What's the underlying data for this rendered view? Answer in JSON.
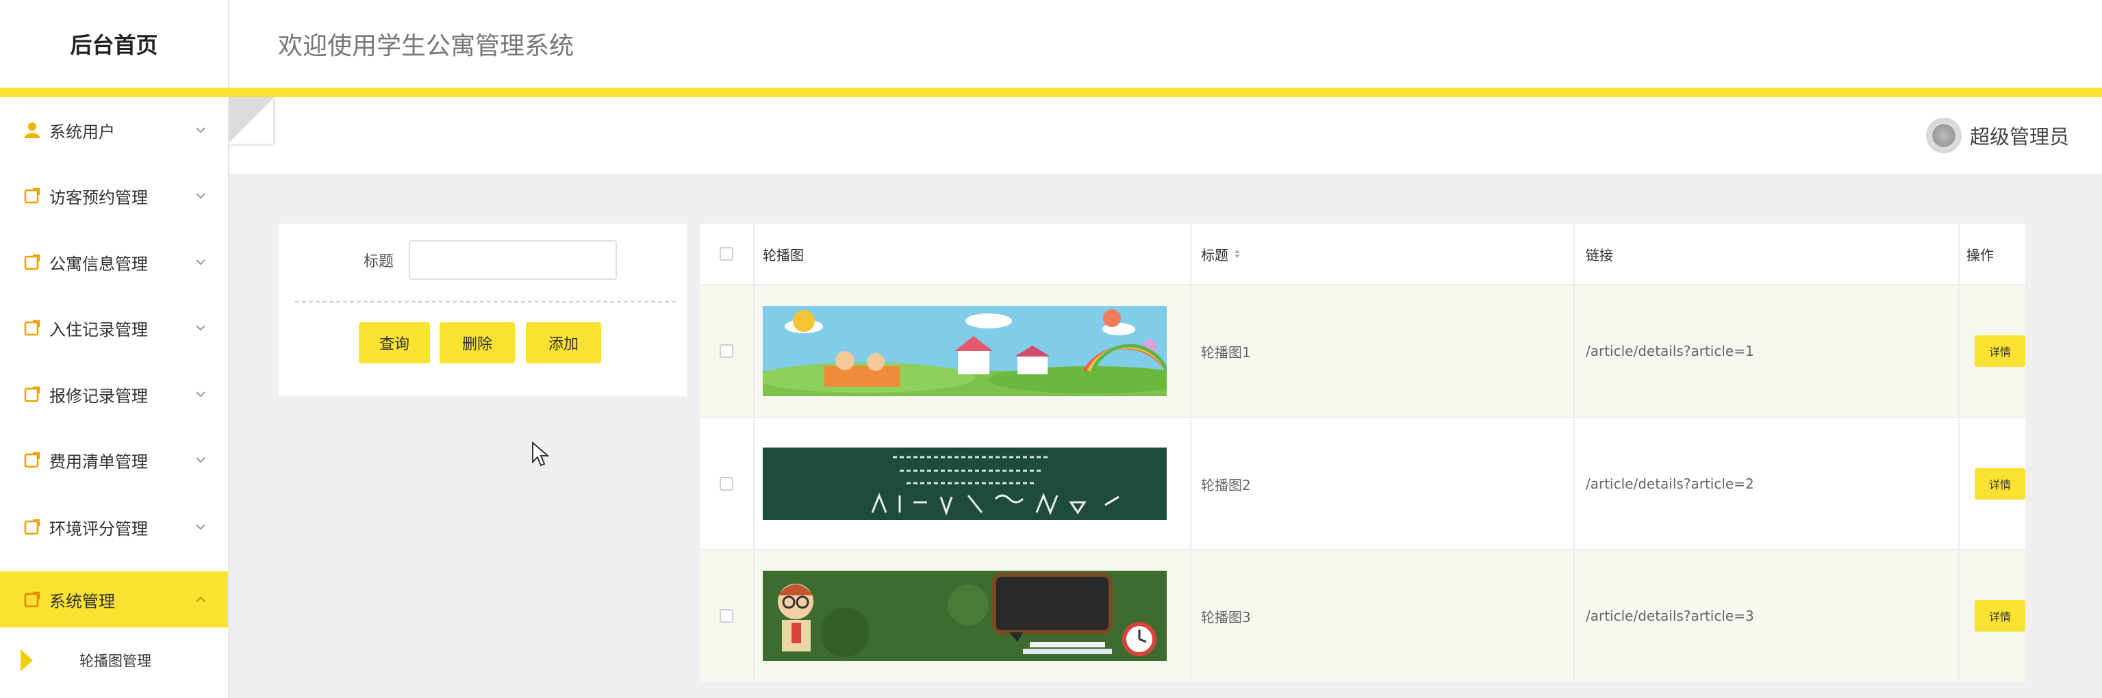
{
  "header": {
    "brand": "后台首页",
    "welcome": "欢迎使用学生公寓管理系统",
    "accent_color": "#f9e231"
  },
  "sidebar": {
    "items": [
      {
        "label": "系统用户",
        "icon": "user-icon",
        "expanded": false
      },
      {
        "label": "访客预约管理",
        "icon": "folder-icon",
        "expanded": false
      },
      {
        "label": "公寓信息管理",
        "icon": "folder-icon",
        "expanded": false
      },
      {
        "label": "入住记录管理",
        "icon": "folder-icon",
        "expanded": false
      },
      {
        "label": "报修记录管理",
        "icon": "folder-icon",
        "expanded": false
      },
      {
        "label": "费用清单管理",
        "icon": "folder-icon",
        "expanded": false
      },
      {
        "label": "环境评分管理",
        "icon": "folder-icon",
        "expanded": false
      },
      {
        "label": "系统管理",
        "icon": "folder-icon",
        "expanded": true,
        "active": true
      }
    ],
    "subitems": [
      {
        "label": "轮播图管理",
        "selected": true
      }
    ]
  },
  "topbar": {
    "user_name": "超级管理员",
    "avatar_icon": "avatar-icon"
  },
  "search": {
    "title_label": "标题",
    "title_value": "",
    "query_button": "查询",
    "delete_button": "删除",
    "add_button": "添加"
  },
  "table": {
    "columns": {
      "image": "轮播图",
      "title": "标题",
      "link": "链接",
      "actions": "操作"
    },
    "rows": [
      {
        "image": "children-playground-banner",
        "title": "轮播图1",
        "link": "/article/details?article=1",
        "action": "详情"
      },
      {
        "image": "chalkboard-banner",
        "title": "轮播图2",
        "link": "/article/details?article=2",
        "action": "详情"
      },
      {
        "image": "cartoon-teacher-banner",
        "title": "轮播图3",
        "link": "/article/details?article=3",
        "action": "详情"
      }
    ]
  }
}
